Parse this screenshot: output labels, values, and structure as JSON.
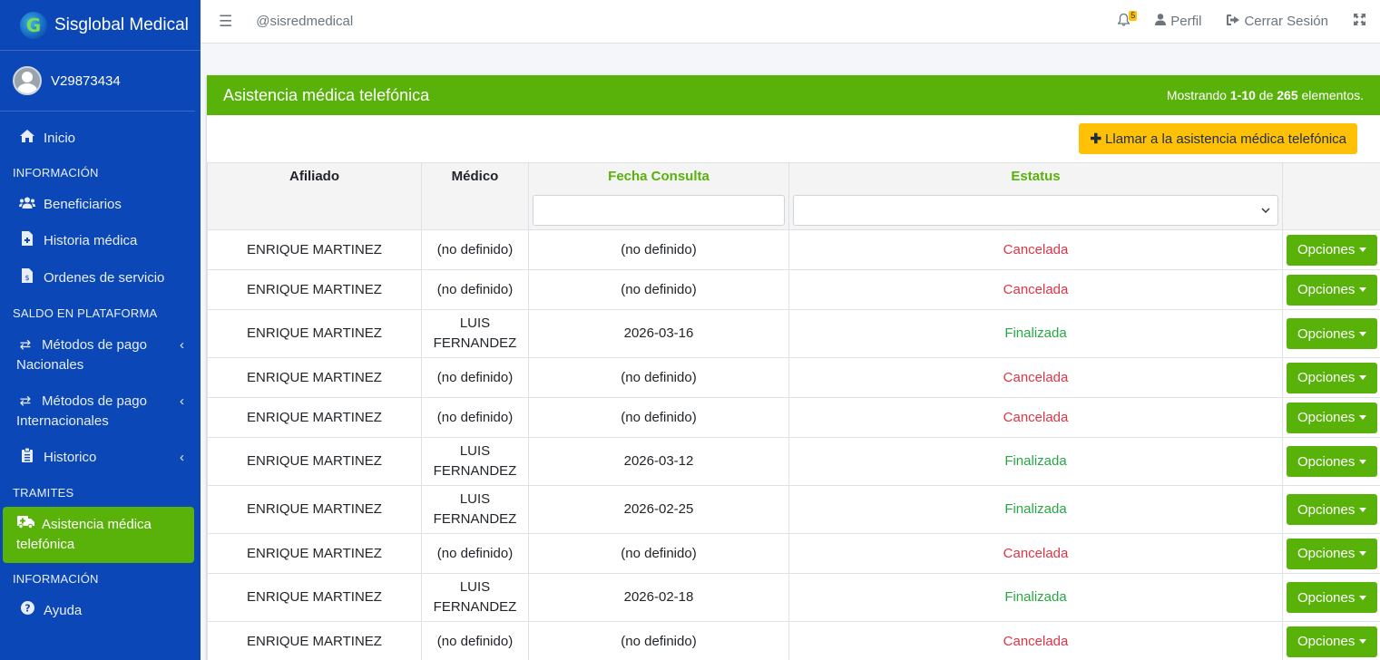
{
  "sidebar": {
    "brand": "Sisglobal Medical",
    "brand_logo_letter": "G",
    "user": "V29873434",
    "items": [
      {
        "type": "item",
        "icon": "home-icon",
        "label": "Inicio"
      },
      {
        "type": "header",
        "label": "INFORMACIÓN"
      },
      {
        "type": "item",
        "icon": "users-icon",
        "label": "Beneficiarios"
      },
      {
        "type": "item",
        "icon": "file-medical-icon",
        "label": "Historia médica"
      },
      {
        "type": "item",
        "icon": "file-invoice-icon",
        "label": "Ordenes de servicio"
      },
      {
        "type": "header",
        "label": "SALDO EN PLATAFORMA"
      },
      {
        "type": "item",
        "icon": "exchange-icon",
        "label_line1": "Métodos de pago",
        "label_line2": "Nacionales"
      },
      {
        "type": "item",
        "icon": "exchange-icon",
        "label_line1": "Métodos de pago",
        "label_line2": "Internacionales"
      },
      {
        "type": "item",
        "icon": "clipboard-list-icon",
        "label": "Historico"
      },
      {
        "type": "header",
        "label": "TRAMITES"
      },
      {
        "type": "item",
        "icon": "ambulance-icon",
        "label_line1": "Asistencia médica",
        "label_line2": "telefónica",
        "active": true
      },
      {
        "type": "header",
        "label": "INFORMACIÓN"
      },
      {
        "type": "item",
        "icon": "question-circle-icon",
        "label": "Ayuda"
      }
    ]
  },
  "topbar": {
    "handle": "@sisredmedical",
    "notifications_count": "5",
    "profile_label": "Perfil",
    "logout_label": "Cerrar Sesión"
  },
  "card": {
    "title": "Asistencia médica telefónica",
    "summary_prefix": "Mostrando ",
    "summary_range": "1-10",
    "summary_mid": " de ",
    "summary_total": "265",
    "summary_suffix": " elementos.",
    "call_button": "Llamar a la asistencia médica telefónica"
  },
  "table": {
    "columns": {
      "afiliado": "Afiliado",
      "medico": "Médico",
      "fecha": "Fecha Consulta",
      "estatus": "Estatus"
    },
    "options_label": "Opciones",
    "rows": [
      {
        "afiliado": "ENRIQUE MARTINEZ",
        "medico": "(no definido)",
        "fecha": "(no definido)",
        "estatus": "Cancelada"
      },
      {
        "afiliado": "ENRIQUE MARTINEZ",
        "medico": "(no definido)",
        "fecha": "(no definido)",
        "estatus": "Cancelada"
      },
      {
        "afiliado": "ENRIQUE MARTINEZ",
        "medico": "LUIS FERNANDEZ",
        "fecha": "2026-03-16",
        "estatus": "Finalizada"
      },
      {
        "afiliado": "ENRIQUE MARTINEZ",
        "medico": "(no definido)",
        "fecha": "(no definido)",
        "estatus": "Cancelada"
      },
      {
        "afiliado": "ENRIQUE MARTINEZ",
        "medico": "(no definido)",
        "fecha": "(no definido)",
        "estatus": "Cancelada"
      },
      {
        "afiliado": "ENRIQUE MARTINEZ",
        "medico": "LUIS FERNANDEZ",
        "fecha": "2026-03-12",
        "estatus": "Finalizada"
      },
      {
        "afiliado": "ENRIQUE MARTINEZ",
        "medico": "LUIS FERNANDEZ",
        "fecha": "2026-02-25",
        "estatus": "Finalizada"
      },
      {
        "afiliado": "ENRIQUE MARTINEZ",
        "medico": "(no definido)",
        "fecha": "(no definido)",
        "estatus": "Cancelada"
      },
      {
        "afiliado": "ENRIQUE MARTINEZ",
        "medico": "LUIS FERNANDEZ",
        "fecha": "2026-02-18",
        "estatus": "Finalizada"
      },
      {
        "afiliado": "ENRIQUE MARTINEZ",
        "medico": "(no definido)",
        "fecha": "(no definido)",
        "estatus": "Cancelada"
      }
    ]
  },
  "colors": {
    "sidebar_bg": "#0b47b6",
    "accent_green": "#58b20a",
    "warning_yellow": "#ffc107",
    "status_cancelled": "#dc3545",
    "status_finished": "#28a745"
  }
}
